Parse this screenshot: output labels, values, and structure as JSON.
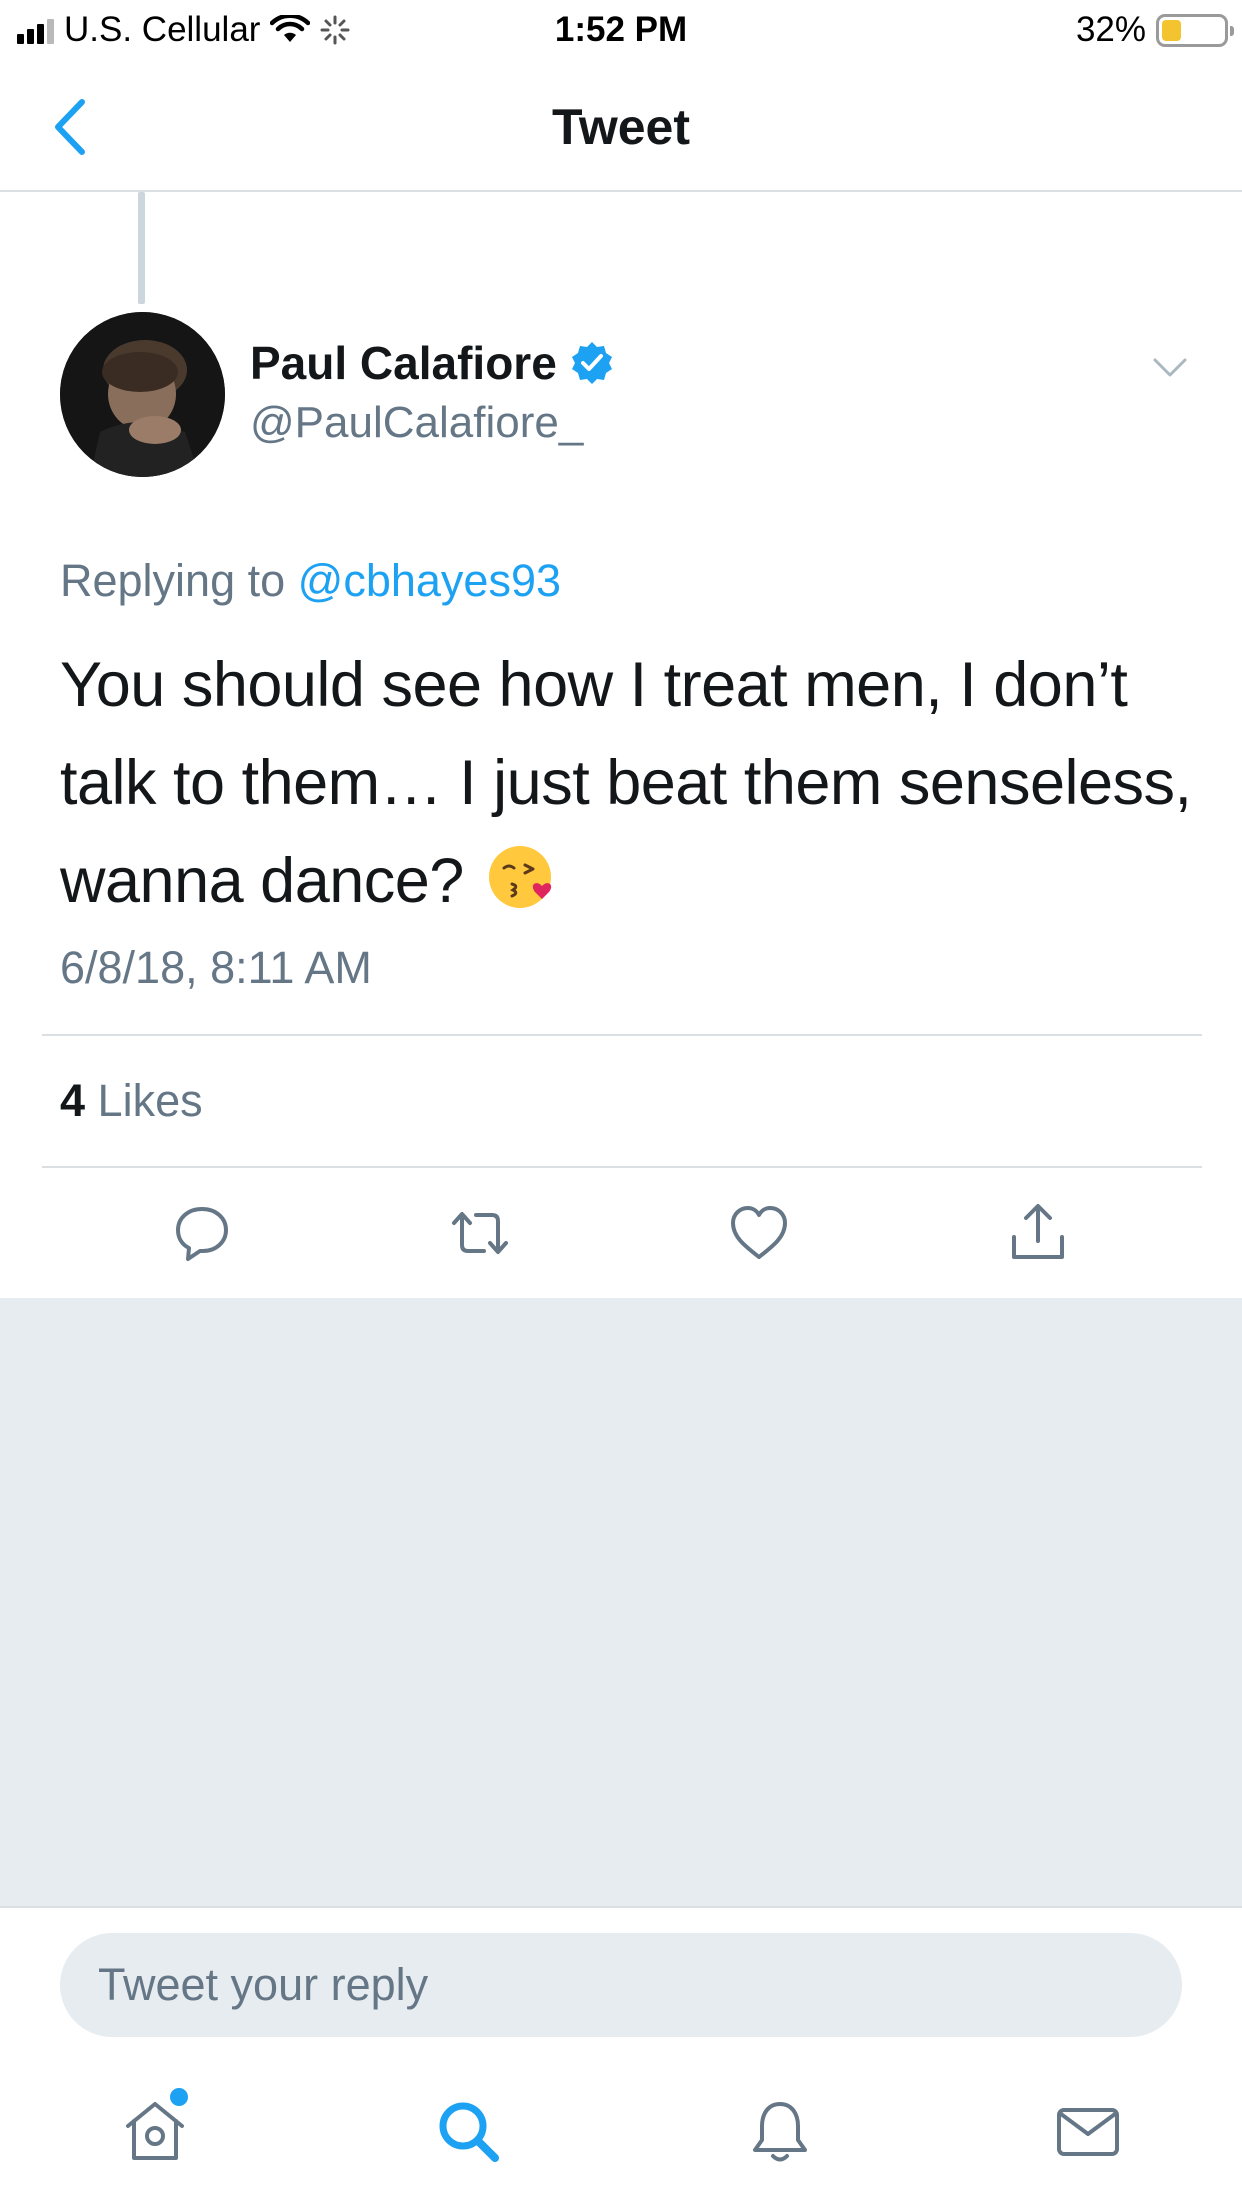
{
  "status_bar": {
    "carrier": "U.S. Cellular",
    "time": "1:52 PM",
    "battery_percent": "32%",
    "battery_level": 0.32,
    "icons": [
      "signal-icon",
      "wifi-icon",
      "activity-spinner-icon",
      "battery-icon"
    ]
  },
  "nav": {
    "title": "Tweet",
    "back_icon": "chevron-left-icon"
  },
  "tweet": {
    "author_name": "Paul Calafiore",
    "verified": true,
    "handle": "@PaulCalafiore_",
    "replying_prefix": "Replying to",
    "replying_to": "@cbhayes93",
    "text": "You should see how I treat men, I don’t talk to them… I just beat them senseless, wanna dance?",
    "emoji": "face-blowing-a-kiss-emoji",
    "timestamp": "6/8/18, 8:11 AM",
    "likes_count": "4",
    "likes_label": "Likes"
  },
  "actions": [
    "reply-icon",
    "retweet-icon",
    "like-icon",
    "share-icon"
  ],
  "reply_bar": {
    "placeholder": "Tweet your reply"
  },
  "tabbar": {
    "items": [
      "home-icon",
      "search-icon",
      "notifications-icon",
      "messages-icon"
    ],
    "active": "search-icon",
    "accent_color": "#1da1f2"
  },
  "colors": {
    "accent": "#1da1f2",
    "secondary_text": "#657786",
    "background_gray": "#e6ecf0"
  }
}
